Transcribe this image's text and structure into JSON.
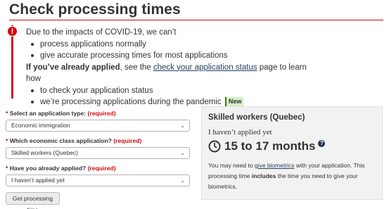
{
  "page": {
    "title": "Check processing times"
  },
  "alert": {
    "intro": "Due to the impacts of COVID-19, we can’t",
    "bullets": [
      "process applications normally",
      "give accurate processing times for most applications"
    ],
    "applied_bold": "If you’ve already applied",
    "applied_pre": ", see the ",
    "status_link": "check your application status",
    "applied_post": " page to learn how",
    "bullets2": [
      "to check your application status",
      "we’re processing applications during the pandemic"
    ],
    "new_badge": "New"
  },
  "form": {
    "required_marker": "*",
    "required_text": "(required)",
    "fields": [
      {
        "label": "Select an application type:",
        "value": "Economic immigration"
      },
      {
        "label": "Which economic class application?",
        "value": "Skilled workers (Quebec)"
      },
      {
        "label": "Have you already applied?",
        "value": "I haven’t applied yet"
      }
    ],
    "submit_label": "Get processing time"
  },
  "result": {
    "title": "Skilled workers (Quebec)",
    "status": "I haven’t applied yet",
    "time": "15 to 17 months",
    "note_pre": "You may need to ",
    "note_link": "give biometrics",
    "note_mid": " with your application. This processing time ",
    "note_bold": "includes",
    "note_post": " the time you need to give your biometrics."
  },
  "colors": {
    "accent_red": "#d3080c",
    "link": "#284162",
    "panel_bg": "#f2f2f2",
    "new_badge_bg": "#d8eeca"
  },
  "icons": [
    "alert-icon",
    "chevron-down-icon",
    "clock-icon",
    "help-icon"
  ]
}
